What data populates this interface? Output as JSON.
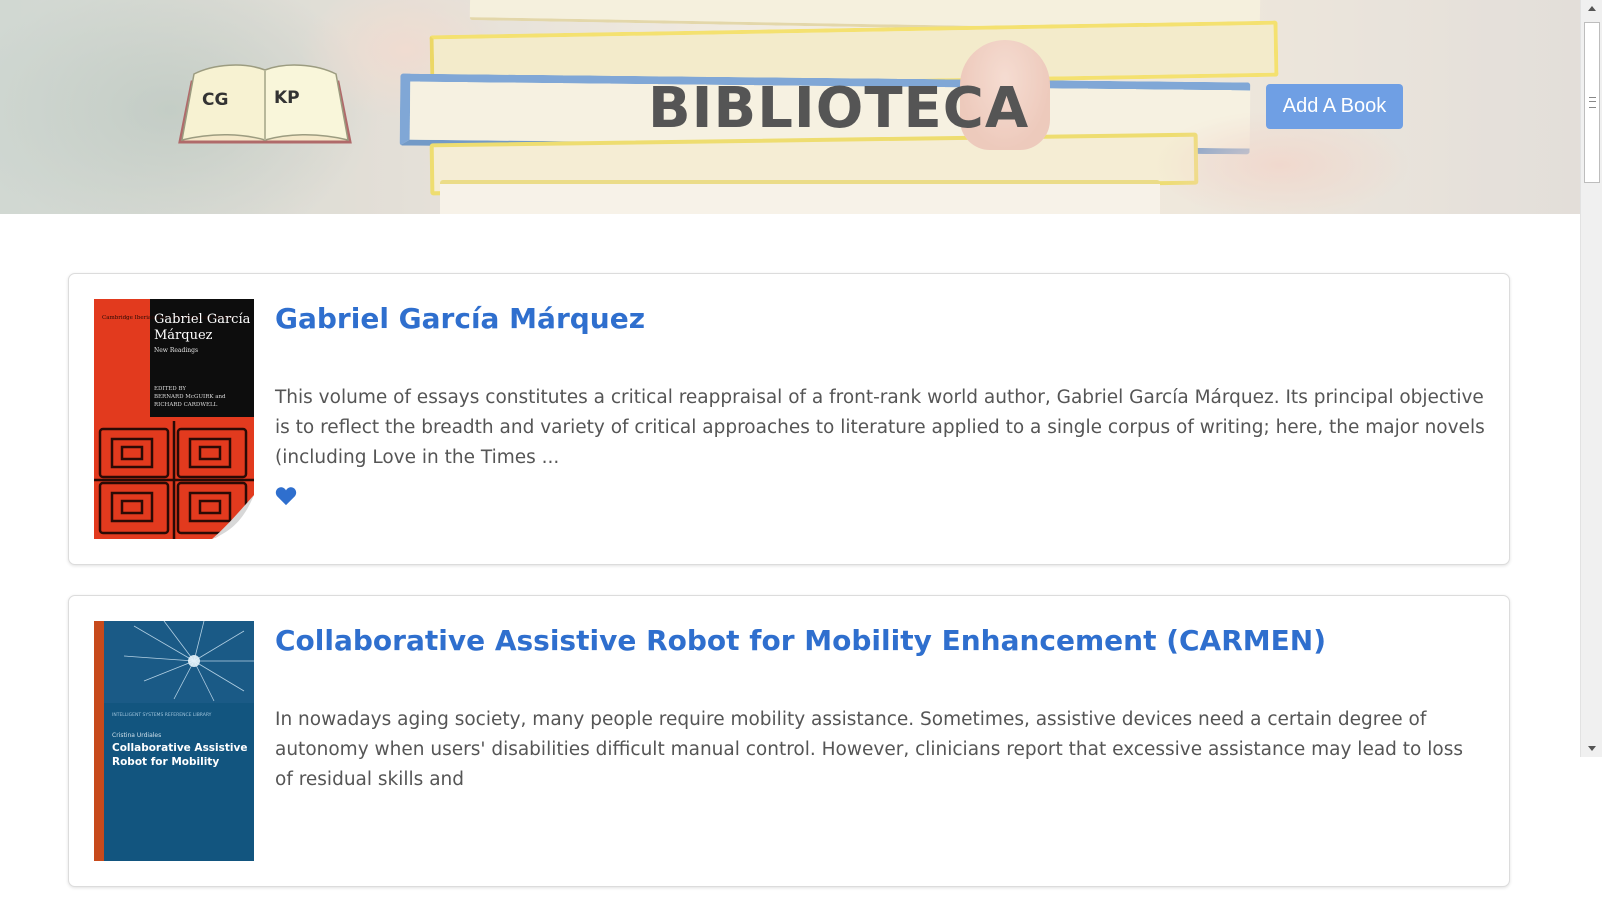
{
  "header": {
    "logo_text_left": "CG",
    "logo_text_right": "KP",
    "title": "BIBLIOTECA",
    "add_book_label": "Add A Book"
  },
  "books": [
    {
      "title": "Gabriel García Márquez",
      "description": "This volume of essays constitutes a critical reappraisal of a front-rank world author, Gabriel García Márquez. Its principal objective is to reflect the breadth and variety of critical approaches to literature applied to a single corpus of writing; here, the major novels (including Love in the Times ...",
      "cover": {
        "series": "Cambridge Iberian and Latin American Studies",
        "title_line1": "Gabriel García",
        "title_line2": "Márquez",
        "subtitle": "New Readings",
        "editors_line1": "EDITED BY",
        "editors_line2": "BERNARD McGUIRK and",
        "editors_line3": "RICHARD CARDWELL"
      },
      "favorite_icon": "heart-icon",
      "favorite": true
    },
    {
      "title": "Collaborative Assistive Robot for Mobility Enhancement (CARMEN)",
      "description": "In nowadays aging society, many people require mobility assistance. Sometimes, assistive devices need a certain degree of autonomy when users' disabilities difficult manual control. However, clinicians report that excessive assistance may lead to loss of residual skills and",
      "cover": {
        "series": "INTELLIGENT SYSTEMS REFERENCE LIBRARY",
        "author": "Cristina Urdiales",
        "title_line1": "Collaborative Assistive",
        "title_line2": "Robot for Mobility"
      }
    }
  ],
  "colors": {
    "accent": "#2f6fce",
    "button": "#6f9fe4",
    "title_gray": "#555555",
    "cover1_red": "#e23a1e"
  }
}
